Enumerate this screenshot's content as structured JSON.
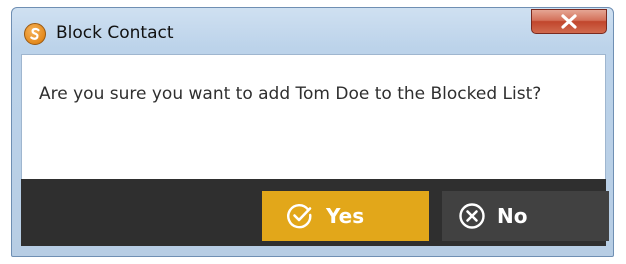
{
  "window": {
    "title": "Block Contact",
    "app_icon": "app-logo-s-icon",
    "close_icon": "close-icon"
  },
  "dialog": {
    "message": "Are you sure you want to add Tom Doe to the Blocked List?"
  },
  "buttons": {
    "yes": {
      "label": "Yes",
      "icon": "check-circle-icon",
      "color": "#e2a71a"
    },
    "no": {
      "label": "No",
      "icon": "x-circle-icon",
      "color": "#414141"
    }
  },
  "colors": {
    "footer_bg": "#2f2f2f",
    "titlebar": "#bcd3ea",
    "close_button": "#c1462c"
  }
}
